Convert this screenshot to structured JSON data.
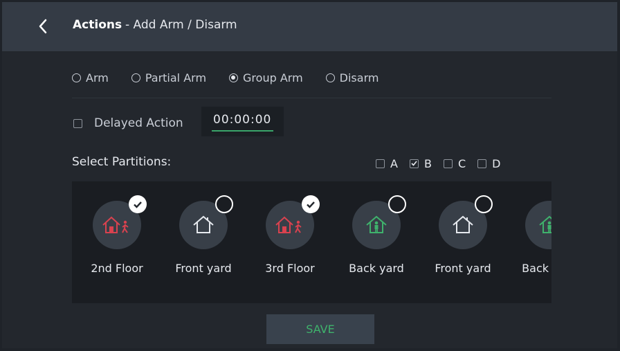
{
  "header": {
    "title": "Actions",
    "subtitle": "- Add Arm / Disarm"
  },
  "mode_options": [
    {
      "label": "Arm",
      "selected": false
    },
    {
      "label": "Partial Arm",
      "selected": false
    },
    {
      "label": "Group Arm",
      "selected": true
    },
    {
      "label": "Disarm",
      "selected": false
    }
  ],
  "delayed_action": {
    "label": "Delayed Action",
    "checked": false,
    "time": "00:00:00"
  },
  "partitions": {
    "label": "Select Partitions:",
    "options": [
      {
        "label": "A",
        "checked": false
      },
      {
        "label": "B",
        "checked": true
      },
      {
        "label": "C",
        "checked": false
      },
      {
        "label": "D",
        "checked": false
      }
    ]
  },
  "zones": [
    {
      "name": "2nd Floor",
      "icon": "house-person-red-icon",
      "selected": true
    },
    {
      "name": "Front yard",
      "icon": "house-outline-icon",
      "selected": false
    },
    {
      "name": "3rd Floor",
      "icon": "house-person-red-icon",
      "selected": true
    },
    {
      "name": "Back yard",
      "icon": "house-person-green-icon",
      "selected": false
    },
    {
      "name": "Front yard",
      "icon": "house-outline-icon",
      "selected": false
    },
    {
      "name": "Back yard",
      "icon": "house-person-green-icon",
      "selected": false
    }
  ],
  "save_label": "SAVE",
  "colors": {
    "accent": "#3fb26c",
    "alert": "#d9424f",
    "header": "#343b45"
  }
}
